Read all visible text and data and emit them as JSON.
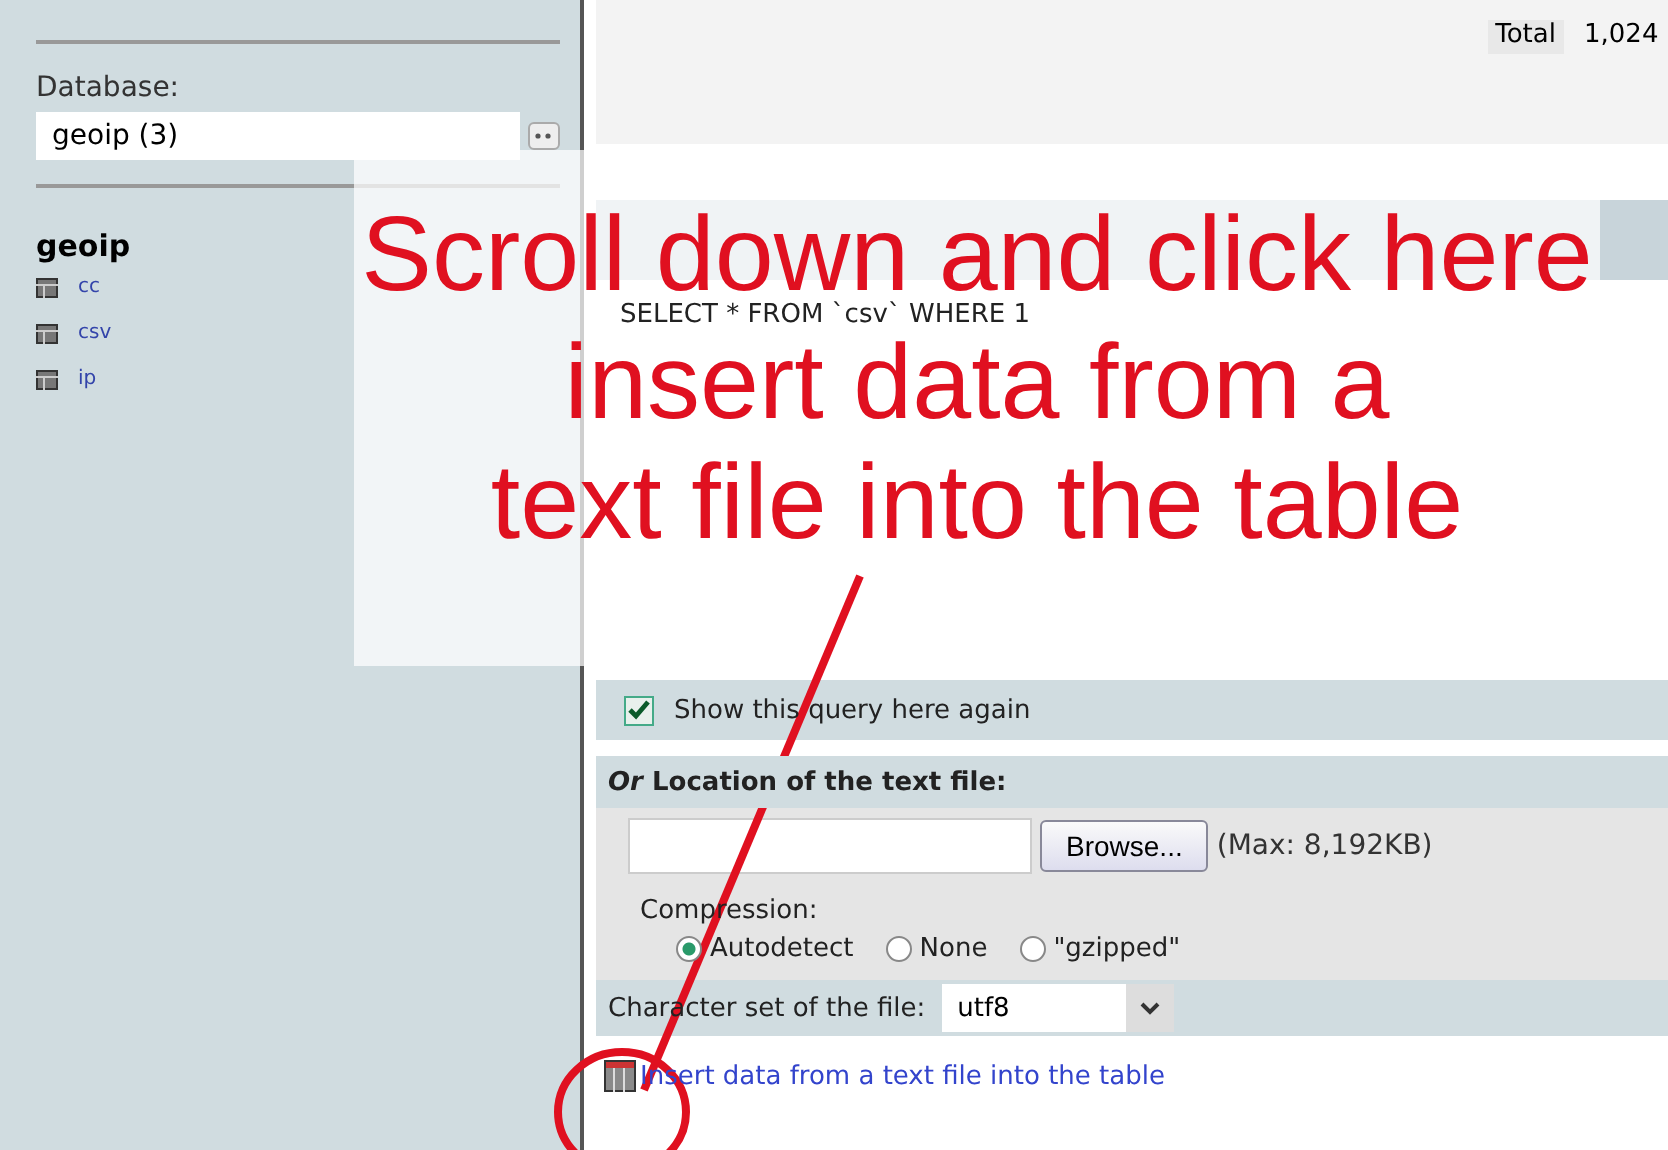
{
  "sidebar": {
    "database_label": "Database:",
    "database_value": "geoip (3)",
    "db_name": "geoip",
    "tables": [
      {
        "name": "cc"
      },
      {
        "name": "csv"
      },
      {
        "name": "ip"
      }
    ]
  },
  "main": {
    "total_label": "Total",
    "total_value": "1,024",
    "query": "SELECT * FROM `csv` WHERE 1",
    "show_query_again": {
      "label": "Show this query here again",
      "checked": true
    },
    "file_section": {
      "title": "*Or* Location of the text file:",
      "browse": "Browse...",
      "max": "(Max: 8,192KB)",
      "compression_label": "Compression:",
      "compression_options": [
        {
          "label": "Autodetect",
          "selected": true
        },
        {
          "label": "None",
          "selected": false
        },
        {
          "label": "\"gzipped\"",
          "selected": false
        }
      ],
      "charset_label": "Character set of the file:",
      "charset_value": "utf8"
    },
    "insert_link": "Insert data from a text file into the table"
  },
  "annotation": {
    "lines": [
      "Scroll down and click here",
      "insert data from a",
      "text file into the table"
    ]
  }
}
